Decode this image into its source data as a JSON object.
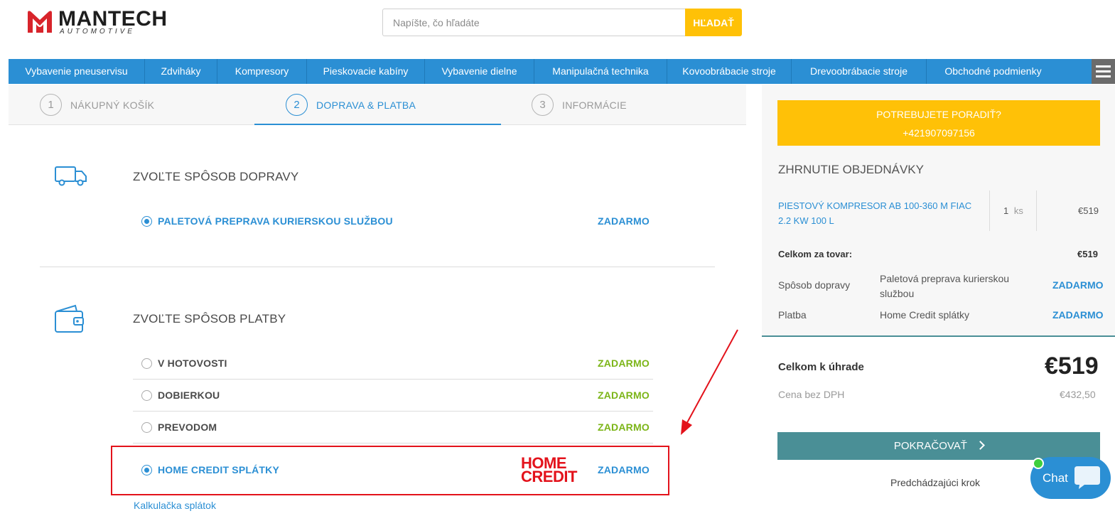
{
  "brand": {
    "name": "MANTECH",
    "tagline": "AUTOMOTIVE"
  },
  "search": {
    "placeholder": "Napíšte, čo hľadáte",
    "button_label": "HĽADAŤ"
  },
  "nav": {
    "items": [
      "Vybavenie pneuservisu",
      "Zdviháky",
      "Kompresory",
      "Pieskovacie kabíny",
      "Vybavenie dielne",
      "Manipulačná technika",
      "Kovoobrábacie stroje",
      "Drevoobrábacie stroje",
      "Obchodné podmienky"
    ]
  },
  "steps": [
    {
      "num": "1",
      "label": "NÁKUPNÝ KOŠÍK"
    },
    {
      "num": "2",
      "label": "DOPRAVA & PLATBA",
      "active": true
    },
    {
      "num": "3",
      "label": "INFORMÁCIE"
    }
  ],
  "shipping": {
    "title": "ZVOĽTE SPÔSOB DOPRAVY",
    "options": [
      {
        "label": "PALETOVÁ PREPRAVA KURIERSKOU SLUŽBOU",
        "price": "ZADARMO",
        "selected": true
      }
    ]
  },
  "payment": {
    "title": "ZVOĽTE SPÔSOB PLATBY",
    "options": [
      {
        "label": "V HOTOVOSTI",
        "price": "ZADARMO",
        "selected": false
      },
      {
        "label": "DOBIERKOU",
        "price": "ZADARMO",
        "selected": false
      },
      {
        "label": "PREVODOM",
        "price": "ZADARMO",
        "selected": false
      },
      {
        "label": "HOME CREDIT SPLÁTKY",
        "price": "ZADARMO",
        "selected": true,
        "logo_line1": "HOME",
        "logo_line2": "CREDIT"
      }
    ],
    "calculator_link": "Kalkulačka splátok"
  },
  "sidebar": {
    "help_line1": "POTREBUJETE PORADIŤ?",
    "help_line2": "+421907097156",
    "summary_title": "ZHRNUTIE OBJEDNÁVKY",
    "product": {
      "name_line1": "PIESTOVÝ KOMPRESOR AB 100-360 M FIAC",
      "name_line2": "2.2 KW 100 L",
      "qty": "1",
      "unit": "ks",
      "price": "€519"
    },
    "goods_total_label": "Celkom za tovar:",
    "goods_total": "€519",
    "shipping_label": "Spôsob dopravy",
    "shipping_value_line1": "Paletová preprava kurierskou",
    "shipping_value_line2": "službou",
    "shipping_price": "ZADARMO",
    "payment_label": "Platba",
    "payment_value": "Home Credit splátky",
    "payment_price": "ZADARMO",
    "total_label": "Celkom k úhrade",
    "total": "€519",
    "net_label": "Cena bez DPH",
    "net": "€432,50",
    "continue_label": "POKRAČOVAŤ",
    "previous_label": "Predchádzajúci krok"
  },
  "chat": {
    "label": "Chat"
  },
  "colors": {
    "primary": "#2b8fd4",
    "accent": "#ffc107",
    "price_green": "#7cb518",
    "annotation_red": "#e3121b",
    "continue": "#4a8f96"
  }
}
